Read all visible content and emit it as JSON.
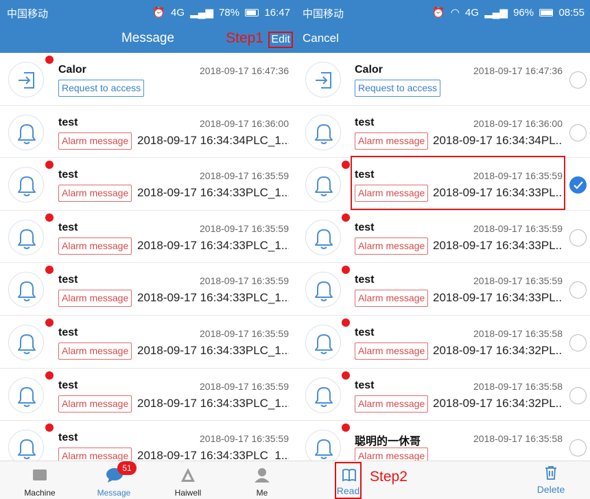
{
  "left": {
    "status": {
      "carrier": "中国移动",
      "signal": "4G",
      "battery": "78%",
      "time": "16:47"
    },
    "header": {
      "title": "Message",
      "step_label": "Step1",
      "edit_label": "Edit"
    },
    "messages": [
      {
        "name": "Calor",
        "time": "2018-09-17 16:47:36",
        "tag": "Request to access",
        "tag_type": "request",
        "detail": "",
        "icon": "enter-icon",
        "unread": true
      },
      {
        "name": "test",
        "time": "2018-09-17 16:36:00",
        "tag": "Alarm message",
        "tag_type": "alarm",
        "detail": "2018-09-17 16:34:34PLC_1....",
        "icon": "bell-icon",
        "unread": false
      },
      {
        "name": "test",
        "time": "2018-09-17 16:35:59",
        "tag": "Alarm message",
        "tag_type": "alarm",
        "detail": "2018-09-17 16:34:33PLC_1....",
        "icon": "bell-icon",
        "unread": true
      },
      {
        "name": "test",
        "time": "2018-09-17 16:35:59",
        "tag": "Alarm message",
        "tag_type": "alarm",
        "detail": "2018-09-17 16:34:33PLC_1....",
        "icon": "bell-icon",
        "unread": true
      },
      {
        "name": "test",
        "time": "2018-09-17 16:35:59",
        "tag": "Alarm message",
        "tag_type": "alarm",
        "detail": "2018-09-17 16:34:33PLC_1....",
        "icon": "bell-icon",
        "unread": true
      },
      {
        "name": "test",
        "time": "2018-09-17 16:35:59",
        "tag": "Alarm message",
        "tag_type": "alarm",
        "detail": "2018-09-17 16:34:33PLC_1....",
        "icon": "bell-icon",
        "unread": true
      },
      {
        "name": "test",
        "time": "2018-09-17 16:35:59",
        "tag": "Alarm message",
        "tag_type": "alarm",
        "detail": "2018-09-17 16:34:33PLC_1....",
        "icon": "bell-icon",
        "unread": true
      },
      {
        "name": "test",
        "time": "2018-09-17 16:35:59",
        "tag": "Alarm message",
        "tag_type": "alarm",
        "detail": "2018-09-17 16:34:33PLC_1....",
        "icon": "bell-icon",
        "unread": true
      }
    ],
    "tabs": [
      {
        "label": "Machine",
        "icon": "machine-icon",
        "active": false
      },
      {
        "label": "Message",
        "icon": "chat-icon",
        "active": true,
        "badge": "51"
      },
      {
        "label": "Haiwell",
        "icon": "haiwell-logo-icon",
        "active": false
      },
      {
        "label": "Me",
        "icon": "user-icon",
        "active": false
      }
    ]
  },
  "right": {
    "status": {
      "carrier": "中国移动",
      "signal": "4G",
      "battery": "96%",
      "time": "08:55"
    },
    "header": {
      "cancel_label": "Cancel"
    },
    "messages": [
      {
        "name": "Calor",
        "time": "2018-09-17 16:47:36",
        "tag": "Request to access",
        "tag_type": "request",
        "detail": "",
        "icon": "enter-icon",
        "unread": false,
        "checked": false
      },
      {
        "name": "test",
        "time": "2018-09-17 16:36:00",
        "tag": "Alarm message",
        "tag_type": "alarm",
        "detail": "2018-09-17 16:34:34PL...",
        "icon": "bell-icon",
        "unread": false,
        "checked": false
      },
      {
        "name": "test",
        "time": "2018-09-17 16:35:59",
        "tag": "Alarm message",
        "tag_type": "alarm",
        "detail": "2018-09-17 16:34:33PL...",
        "icon": "bell-icon",
        "unread": true,
        "checked": true
      },
      {
        "name": "test",
        "time": "2018-09-17 16:35:59",
        "tag": "Alarm message",
        "tag_type": "alarm",
        "detail": "2018-09-17 16:34:33PL...",
        "icon": "bell-icon",
        "unread": true,
        "checked": false
      },
      {
        "name": "test",
        "time": "2018-09-17 16:35:59",
        "tag": "Alarm message",
        "tag_type": "alarm",
        "detail": "2018-09-17 16:34:33PL...",
        "icon": "bell-icon",
        "unread": true,
        "checked": false
      },
      {
        "name": "test",
        "time": "2018-09-17 16:35:58",
        "tag": "Alarm message",
        "tag_type": "alarm",
        "detail": "2018-09-17 16:34:32PL...",
        "icon": "bell-icon",
        "unread": true,
        "checked": false
      },
      {
        "name": "test",
        "time": "2018-09-17 16:35:58",
        "tag": "Alarm message",
        "tag_type": "alarm",
        "detail": "2018-09-17 16:34:32PL...",
        "icon": "bell-icon",
        "unread": true,
        "checked": false
      },
      {
        "name": "聪明的一休哥",
        "time": "2018-09-17 16:35:58",
        "tag": "Alarm message",
        "tag_type": "alarm",
        "detail": "",
        "icon": "bell-icon",
        "unread": true,
        "checked": false
      }
    ],
    "actions": {
      "read_label": "Read",
      "step_label": "Step2",
      "delete_label": "Delete"
    }
  },
  "colors": {
    "primary": "#3a85c9",
    "unread_dot": "#e8181e",
    "alarm_tag": "#d84a4a",
    "request_tag": "#3a7fc9",
    "highlight": "#e01010",
    "checked": "#2f7fe0"
  }
}
